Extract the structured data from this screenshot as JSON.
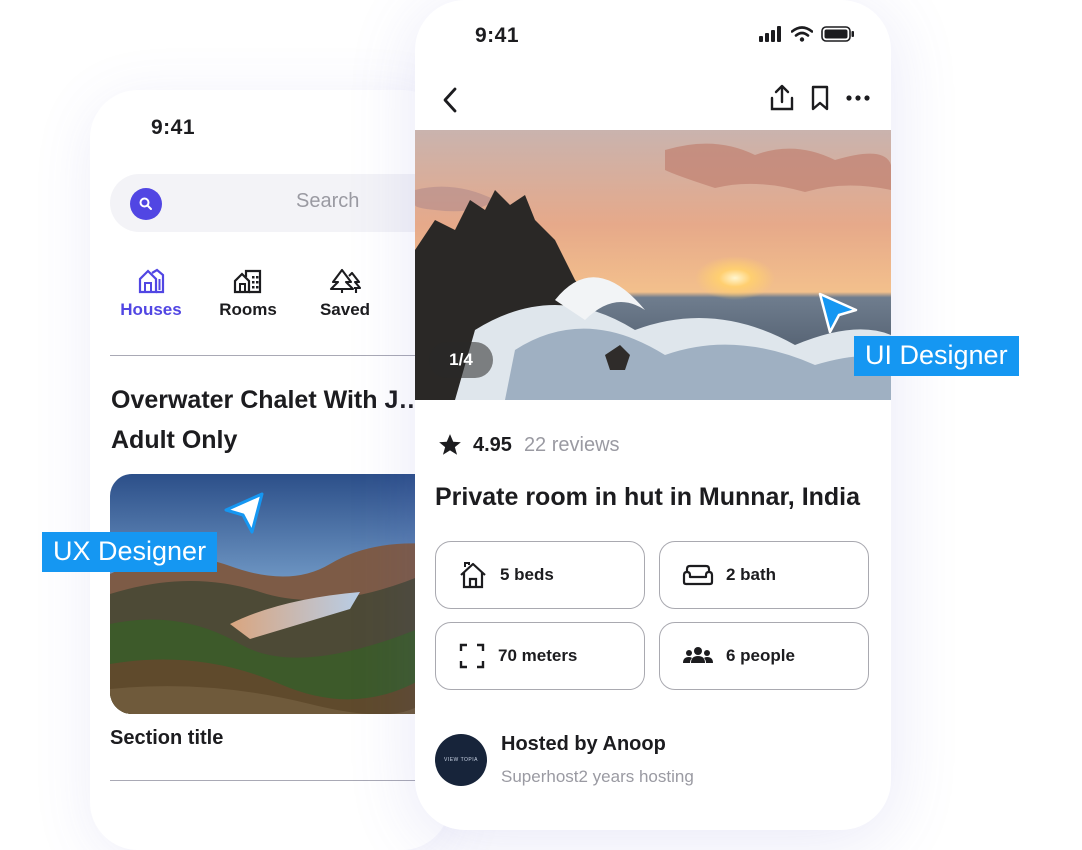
{
  "left_screen": {
    "time": "9:41",
    "search_placeholder": "Search",
    "categories": [
      {
        "label": "Houses",
        "icon": "houses-icon",
        "active": true
      },
      {
        "label": "Rooms",
        "icon": "rooms-icon",
        "active": false
      },
      {
        "label": "Saved",
        "icon": "trees-icon",
        "active": false
      }
    ],
    "listing_title": "Overwater Chalet With J…",
    "listing_title_line2": "Adult Only",
    "section_title": "Section title"
  },
  "right_screen": {
    "time": "9:41",
    "photo_counter": "1/4",
    "rating": "4.95",
    "reviews": "22 reviews",
    "title": "Private room in hut in Munnar, India",
    "features": [
      {
        "label": "5 beds",
        "icon": "house-icon"
      },
      {
        "label": "2 bath",
        "icon": "bath-icon"
      },
      {
        "label": "70 meters",
        "icon": "area-icon"
      },
      {
        "label": "6 people",
        "icon": "people-icon"
      }
    ],
    "host_name": "Hosted by Anoop",
    "host_sub": "Superhost2 years hosting",
    "host_logo_text": "VIEW TOPIA"
  },
  "labels": {
    "ui": "UI Designer",
    "ux": "UX Designer"
  },
  "colors": {
    "accent": "#5146e3",
    "tag": "#1597f2"
  }
}
